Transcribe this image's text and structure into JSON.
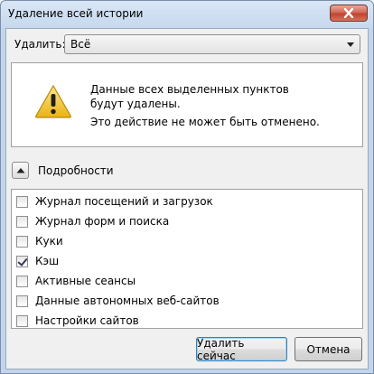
{
  "window": {
    "title": "Удаление всей истории"
  },
  "time_range": {
    "label": "Удалить:",
    "value": "Всё"
  },
  "warning": {
    "line1": "Данные всех выделенных пунктов будут удалены.",
    "line2": "Это действие не может быть отменено."
  },
  "details": {
    "label": "Подробности"
  },
  "items": [
    {
      "label": "Журнал посещений и загрузок",
      "checked": false
    },
    {
      "label": "Журнал форм и поиска",
      "checked": false
    },
    {
      "label": "Куки",
      "checked": false
    },
    {
      "label": "Кэш",
      "checked": true
    },
    {
      "label": "Активные сеансы",
      "checked": false
    },
    {
      "label": "Данные автономных веб-сайтов",
      "checked": false
    },
    {
      "label": "Настройки сайтов",
      "checked": false
    }
  ],
  "buttons": {
    "clear_now": "Удалить сейчас",
    "cancel": "Отмена"
  },
  "icons": {
    "close": "close-icon",
    "warning": "warning-icon",
    "collapse": "chevron-up-icon",
    "dropdown": "chevron-down-icon"
  }
}
